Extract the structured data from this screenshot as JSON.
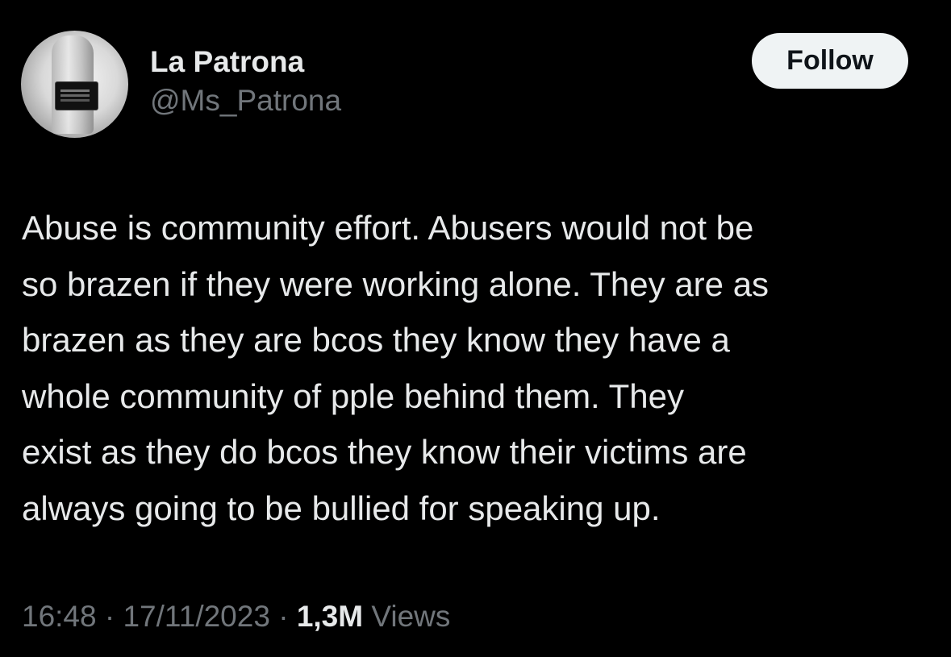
{
  "author": {
    "display_name": "La Patrona",
    "handle": "@Ms_Patrona",
    "avatar_icon": "profile-photo"
  },
  "follow_button": {
    "label": "Follow"
  },
  "tweet": {
    "text": "Abuse is community effort. Abusers would not be\nso brazen if they were working alone. They are as\nbrazen as they are bcos they know they have a\nwhole community of pple behind them. They\nexist as they do bcos they know their victims are\nalways going to be bullied for speaking up."
  },
  "meta": {
    "time": "16:48",
    "separator": " · ",
    "date": "17/11/2023",
    "views_count": "1,3M",
    "views_label": "Views"
  },
  "colors": {
    "background": "#000000",
    "primary_text": "#e7e9ea",
    "secondary_text": "#71767b",
    "button_bg": "#eff3f4",
    "button_text": "#0f1419"
  }
}
